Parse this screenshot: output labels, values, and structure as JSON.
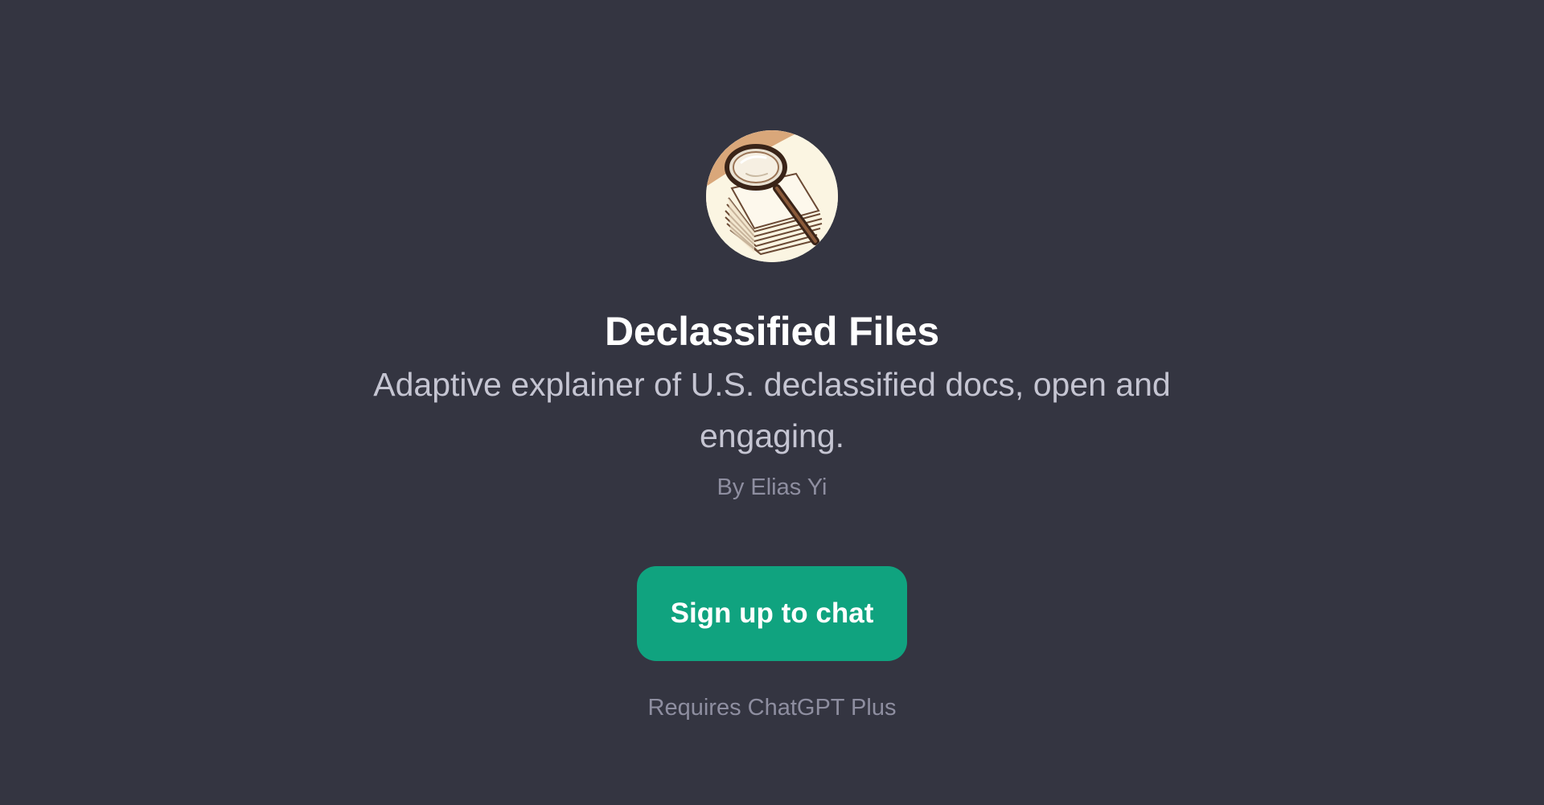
{
  "gpt": {
    "title": "Declassified Files",
    "description": "Adaptive explainer of U.S. declassified docs, open and engaging.",
    "author": "By Elias Yi",
    "avatar_icon": "magnifying-glass-over-documents-icon"
  },
  "cta": {
    "label": "Sign up to chat"
  },
  "footer": {
    "requirement": "Requires ChatGPT Plus"
  },
  "colors": {
    "background": "#343541",
    "accent": "#10a37f",
    "title": "#ffffff",
    "description": "#c5c5d2",
    "muted": "#8e8ea0"
  }
}
